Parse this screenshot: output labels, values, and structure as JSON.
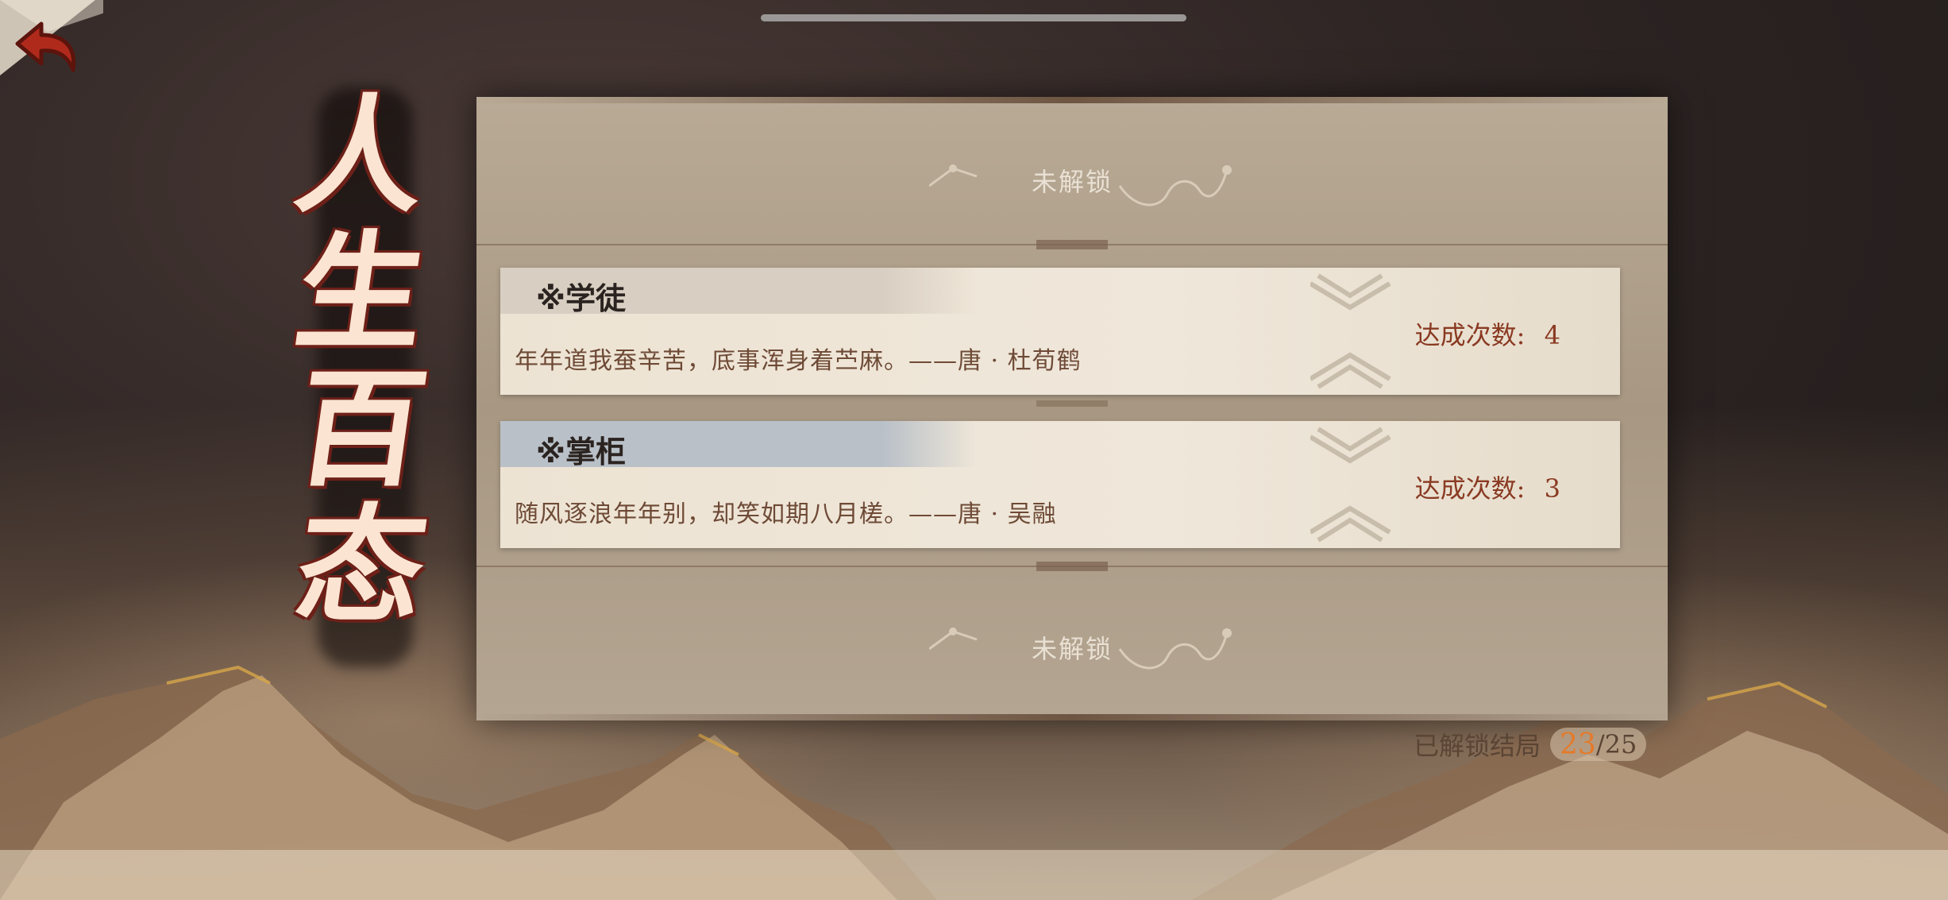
{
  "screen": {
    "title_chars": [
      "人",
      "生",
      "百",
      "态"
    ]
  },
  "controls": {
    "back_icon": "back-arrow-icon"
  },
  "endings": [
    {
      "locked": true,
      "label": "未解锁"
    },
    {
      "locked": false,
      "title": "※学徒",
      "quote": "年年道我蚕辛苦，底事浑身着苎麻。——唐 · 杜荀鹤",
      "count_label": "达成次数:",
      "count_value": "4",
      "band_color": "#d8cfc2"
    },
    {
      "locked": false,
      "title": "※掌柜",
      "quote": "随风逐浪年年别，却笑如期八月槎。——唐 · 吴融",
      "count_label": "达成次数:",
      "count_value": "3",
      "band_color": "#b9c0c8"
    },
    {
      "locked": true,
      "label": "未解锁"
    }
  ],
  "progress": {
    "label": "已解锁结局",
    "current": "23",
    "separator": "/",
    "total": "25"
  },
  "colors": {
    "accent": "#e57a2a",
    "title_fill": "#fbe4d2",
    "title_outline": "#6d2018"
  }
}
